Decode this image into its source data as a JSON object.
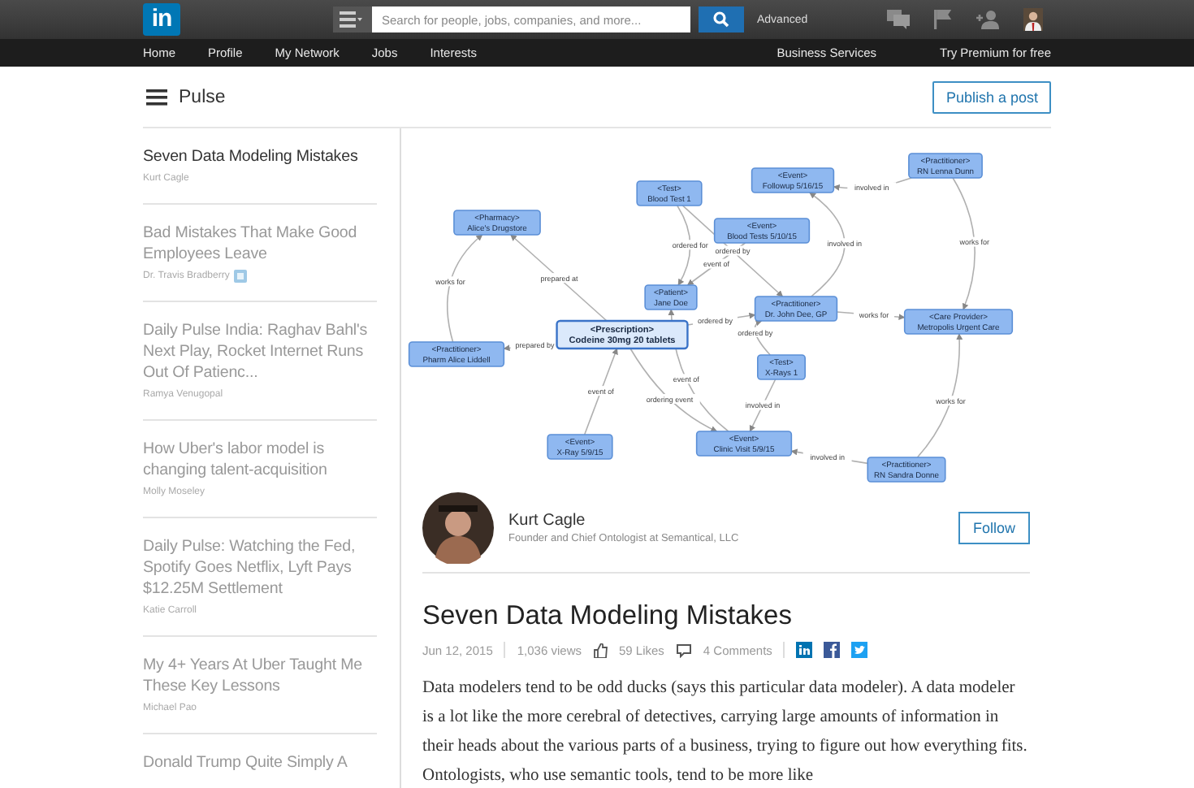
{
  "top_bar": {
    "logo": "in",
    "search": {
      "placeholder": "Search for people, jobs, companies, and more..."
    },
    "advanced": "Advanced"
  },
  "nav": {
    "left": [
      "Home",
      "Profile",
      "My Network",
      "Jobs",
      "Interests"
    ],
    "right": [
      "Business Services",
      "Try Premium for free"
    ]
  },
  "pulse_bar": {
    "title": "Pulse",
    "publish_button": "Publish a post"
  },
  "sidebar": {
    "items": [
      {
        "title": "Seven Data Modeling Mistakes",
        "author": "Kurt Cagle",
        "selected": true,
        "influencer": false
      },
      {
        "title": "Bad Mistakes That Make Good Employees Leave",
        "author": "Dr. Travis Bradberry",
        "selected": false,
        "influencer": true
      },
      {
        "title": "Daily Pulse India: Raghav Bahl's Next Play, Rocket Internet Runs Out Of Patienc...",
        "author": "Ramya Venugopal",
        "selected": false,
        "influencer": false
      },
      {
        "title": "How Uber's labor model is changing talent-acquisition",
        "author": "Molly Moseley",
        "selected": false,
        "influencer": false
      },
      {
        "title": "Daily Pulse: Watching the Fed, Spotify Goes Netflix, Lyft Pays $12.25M Settlement",
        "author": "Katie Carroll",
        "selected": false,
        "influencer": false
      },
      {
        "title": "My 4+ Years At Uber Taught Me These Key Lessons",
        "author": "Michael Pao",
        "selected": false,
        "influencer": false
      },
      {
        "title": "Donald Trump Quite Simply A",
        "selected": false,
        "influencer": false
      }
    ]
  },
  "diagram": {
    "nodes": [
      {
        "type": "<Test>",
        "name": "Blood Test 1",
        "highlighted": false
      },
      {
        "type": "<Event>",
        "name": "Followup 5/16/15",
        "highlighted": false
      },
      {
        "type": "<Practitioner>",
        "name": "RN Lenna Dunn",
        "highlighted": false
      },
      {
        "type": "<Pharmacy>",
        "name": "Alice's Drugstore",
        "highlighted": false
      },
      {
        "type": "<Event>",
        "name": "Blood Tests 5/10/15",
        "highlighted": false
      },
      {
        "type": "<Patient>",
        "name": "Jane Doe",
        "highlighted": false
      },
      {
        "type": "<Practitioner>",
        "name": "Dr. John Dee, GP",
        "highlighted": false
      },
      {
        "type": "<Care Provider>",
        "name": "Metropolis Urgent Care",
        "highlighted": false
      },
      {
        "type": "<Prescription>",
        "name": "Codeine 30mg 20 tablets",
        "highlighted": true
      },
      {
        "type": "<Practitioner>",
        "name": "Pharm Alice Liddell",
        "highlighted": false
      },
      {
        "type": "<Test>",
        "name": "X-Rays 1",
        "highlighted": false
      },
      {
        "type": "<Event>",
        "name": "X-Ray 5/9/15",
        "highlighted": false
      },
      {
        "type": "<Event>",
        "name": "Clinic Visit 5/9/15",
        "highlighted": false
      },
      {
        "type": "<Practitioner>",
        "name": "RN Sandra Donne",
        "highlighted": false
      }
    ],
    "edge_labels": [
      "ordered for",
      "ordered by",
      "event of",
      "involved in",
      "works for",
      "works for",
      "prepared at",
      "prepared by",
      "ordered by",
      "ordering event",
      "works for",
      "ordered by",
      "involved in",
      "event of",
      "event of",
      "works for",
      "involved in",
      "involved in"
    ]
  },
  "author": {
    "name": "Kurt Cagle",
    "headline": "Founder and Chief Ontologist at Semantical, LLC",
    "follow_button": "Follow"
  },
  "article": {
    "title": "Seven Data Modeling Mistakes",
    "date": "Jun 12, 2015",
    "views": "1,036 views",
    "likes": "59 Likes",
    "comments": "4 Comments",
    "body": "Data modelers tend to be odd ducks (says this particular data modeler). A data modeler is a lot like the more cerebral of detectives, carrying large amounts of information in their heads about the various parts of a business, trying to figure out how everything fits. Ontologists, who use semantic tools, tend to be more like"
  }
}
